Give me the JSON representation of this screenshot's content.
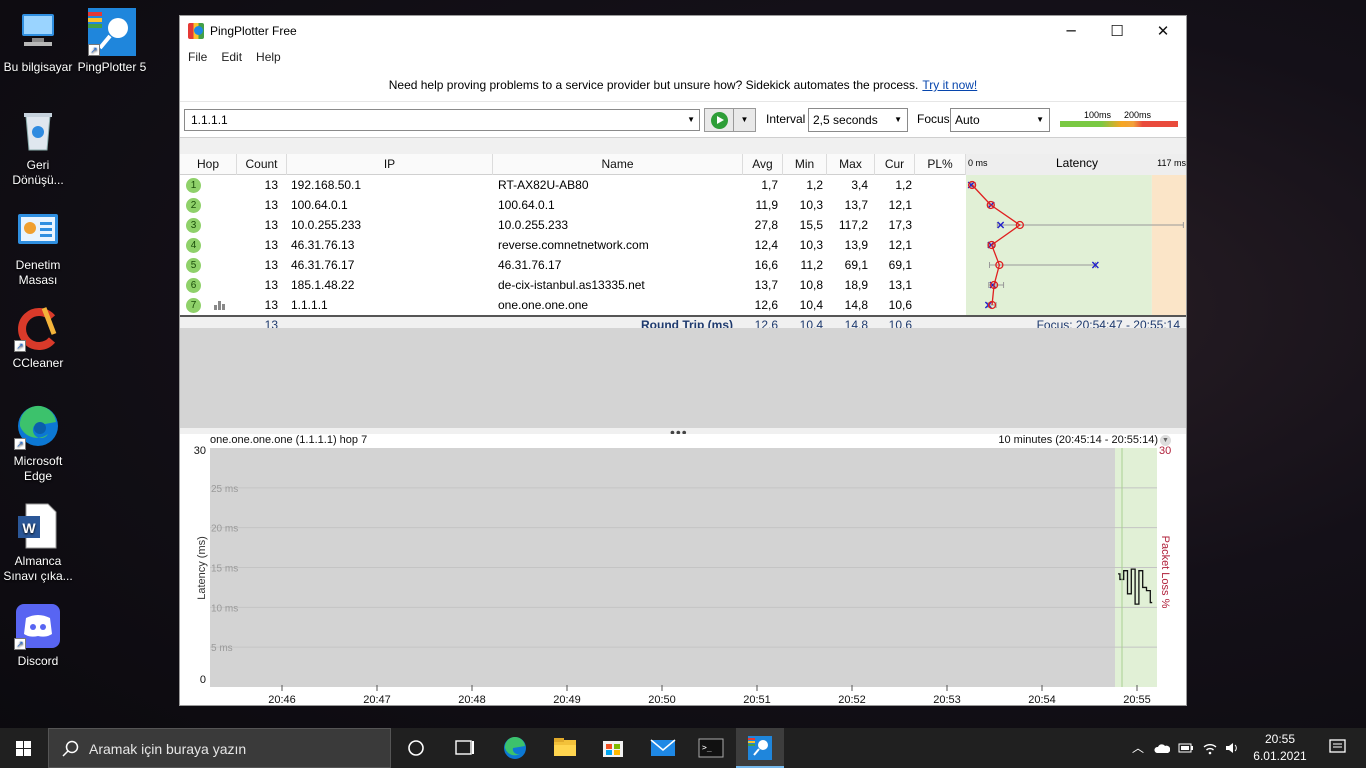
{
  "desktop": {
    "icons": [
      {
        "label": "Bu bilgisayar",
        "icon": "computer-icon"
      },
      {
        "label": "PingPlotter 5",
        "icon": "pingplotter-icon"
      },
      {
        "label": "Geri Dönüşü...",
        "icon": "recycle-bin-icon"
      },
      {
        "label": "Denetim Masası",
        "icon": "control-panel-icon"
      },
      {
        "label": "CCleaner",
        "icon": "ccleaner-icon"
      },
      {
        "label": "Microsoft Edge",
        "icon": "edge-icon"
      },
      {
        "label": "Almanca Sınavı çıka...",
        "icon": "word-doc-icon"
      },
      {
        "label": "Discord",
        "icon": "discord-icon"
      }
    ]
  },
  "window": {
    "title": "PingPlotter Free",
    "menu": [
      "File",
      "Edit",
      "Help"
    ],
    "promo_text": "Need help proving problems to a service provider but unsure how? Sidekick automates the process.",
    "promo_link": "Try it now!",
    "target": "1.1.1.1",
    "interval_label": "Interval",
    "interval_value": "2,5 seconds",
    "focus_label": "Focus",
    "focus_value": "Auto",
    "scale_labels": [
      "100ms",
      "200ms"
    ]
  },
  "grid": {
    "columns": [
      "Hop",
      "Count",
      "IP",
      "Name",
      "Avg",
      "Min",
      "Max",
      "Cur",
      "PL%"
    ],
    "latency_header": "Latency",
    "latency_min_label": "0 ms",
    "latency_max_label": "117 ms",
    "latency_max_ms": 117,
    "rows": [
      {
        "hop": "1",
        "count": "13",
        "ip": "192.168.50.1",
        "name": "RT-AX82U-AB80",
        "avg": "1,7",
        "min": "1,2",
        "max": "3,4",
        "cur": "1,2",
        "pl": ""
      },
      {
        "hop": "2",
        "count": "13",
        "ip": "100.64.0.1",
        "name": "100.64.0.1",
        "avg": "11,9",
        "min": "10,3",
        "max": "13,7",
        "cur": "12,1",
        "pl": ""
      },
      {
        "hop": "3",
        "count": "13",
        "ip": "10.0.255.233",
        "name": "10.0.255.233",
        "avg": "27,8",
        "min": "15,5",
        "max": "117,2",
        "cur": "17,3",
        "pl": ""
      },
      {
        "hop": "4",
        "count": "13",
        "ip": "46.31.76.13",
        "name": "reverse.comnetnetwork.com",
        "avg": "12,4",
        "min": "10,3",
        "max": "13,9",
        "cur": "12,1",
        "pl": ""
      },
      {
        "hop": "5",
        "count": "13",
        "ip": "46.31.76.17",
        "name": "46.31.76.17",
        "avg": "16,6",
        "min": "11,2",
        "max": "69,1",
        "cur": "69,1",
        "pl": ""
      },
      {
        "hop": "6",
        "count": "13",
        "ip": "185.1.48.22",
        "name": "de-cix-istanbul.as13335.net",
        "avg": "13,7",
        "min": "10,8",
        "max": "18,9",
        "cur": "13,1",
        "pl": ""
      },
      {
        "hop": "7",
        "count": "13",
        "ip": "1.1.1.1",
        "name": "one.one.one.one",
        "avg": "12,6",
        "min": "10,4",
        "max": "14,8",
        "cur": "10,6",
        "pl": ""
      }
    ],
    "summary": {
      "count": "13",
      "label": "Round Trip (ms)",
      "avg": "12,6",
      "min": "10,4",
      "max": "14,8",
      "cur": "10,6",
      "focus": "Focus: 20:54:47 - 20:55:14"
    }
  },
  "timegraph": {
    "title": "one.one.one.one (1.1.1.1) hop 7",
    "range": "10 minutes (20:45:14 - 20:55:14)",
    "y_left_label": "Latency (ms)",
    "y_right_label": "Packet Loss %",
    "y_max": "30",
    "y_min": "0",
    "y_right_max": "30",
    "y_ticks": [
      "25 ms",
      "20 ms",
      "15 ms",
      "10 ms",
      "5 ms"
    ],
    "x_ticks": [
      "20:46",
      "20:47",
      "20:48",
      "20:49",
      "20:50",
      "20:51",
      "20:52",
      "20:53",
      "20:54",
      "20:55"
    ]
  },
  "taskbar": {
    "search_placeholder": "Aramak için buraya yazın",
    "time": "20:55",
    "date": "6.01.2021"
  }
}
